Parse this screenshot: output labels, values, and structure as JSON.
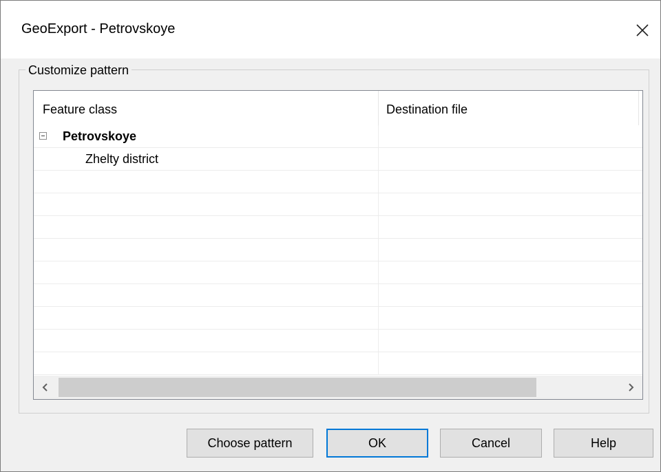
{
  "window": {
    "title": "GeoExport - Petrovskoye",
    "close_icon": "close-icon"
  },
  "group": {
    "label": "Customize pattern"
  },
  "list": {
    "columns": [
      "Feature class",
      "Destination file"
    ],
    "rows": [
      {
        "feature": "Petrovskoye",
        "destination": "",
        "level": 0,
        "expanded": true
      },
      {
        "feature": "Zhelty district",
        "destination": "",
        "level": 1
      }
    ]
  },
  "scrollbar": {
    "left_icon": "chevron-left-icon",
    "right_icon": "chevron-right-icon"
  },
  "buttons": {
    "choose_pattern": "Choose pattern",
    "ok": "OK",
    "cancel": "Cancel",
    "help": "Help"
  },
  "colors": {
    "accent": "#0078d7",
    "dialog_bg": "#f0f0f0",
    "button_bg": "#e1e1e1"
  }
}
